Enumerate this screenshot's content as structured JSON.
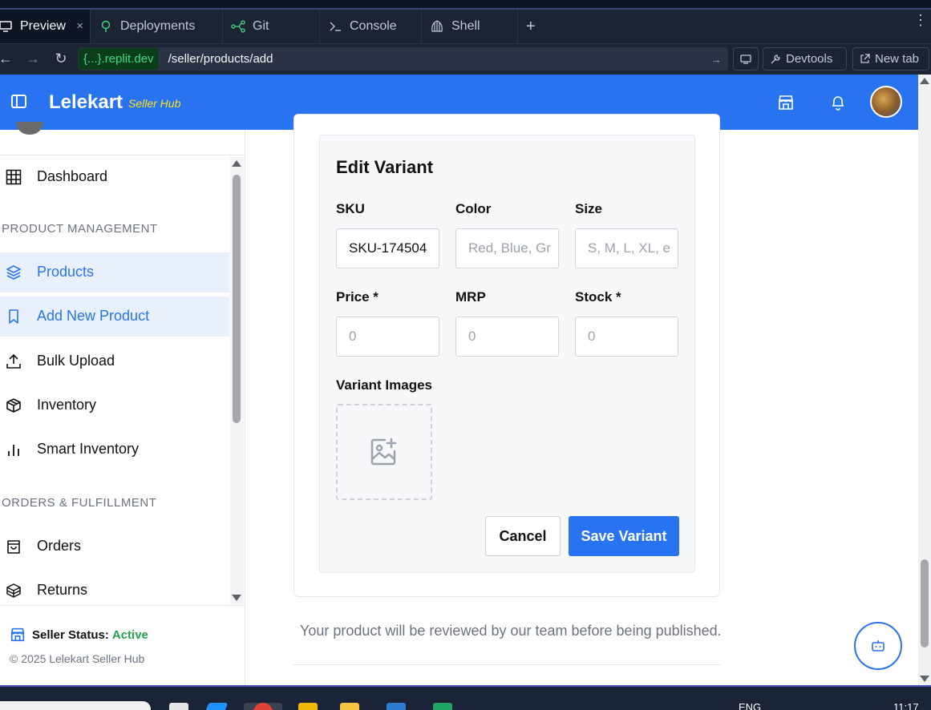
{
  "browser": {
    "tabs": [
      {
        "label": "Preview",
        "active": true,
        "icon": "monitor-icon"
      },
      {
        "label": "Deployments",
        "icon": "deploy-icon"
      },
      {
        "label": "Git",
        "icon": "git-branch-icon"
      },
      {
        "label": "Console",
        "icon": "terminal-icon"
      },
      {
        "label": "Shell",
        "icon": "shell-icon"
      }
    ],
    "close_glyph": "×",
    "new_tab_glyph": "+",
    "url_domain": "{...}.replit.dev",
    "url_path": "/seller/products/add",
    "devtools_label": "Devtools",
    "newtab_label": "New tab"
  },
  "header": {
    "brand": "Lelekart",
    "brand_sub": "Seller Hub"
  },
  "sidebar": {
    "items": [
      {
        "label": "Dashboard",
        "icon": "grid-icon",
        "active": false
      },
      {
        "label": "Products",
        "icon": "layers-icon",
        "active": true
      },
      {
        "label": "Add New Product",
        "icon": "bookmark-icon",
        "active": true
      },
      {
        "label": "Bulk Upload",
        "icon": "upload-icon",
        "active": false
      },
      {
        "label": "Inventory",
        "icon": "box-icon",
        "active": false
      },
      {
        "label": "Smart Inventory",
        "icon": "bar-chart-icon",
        "active": false
      },
      {
        "label": "Orders",
        "icon": "shopping-bag-icon",
        "active": false
      },
      {
        "label": "Returns",
        "icon": "package-icon",
        "active": false
      }
    ],
    "sections": {
      "product_management": "PRODUCT MANAGEMENT",
      "orders_fulfillment": "ORDERS & FULFILLMENT"
    },
    "status_label": "Seller Status:",
    "status_value": "Active",
    "copyright": "© 2025 Lelekart Seller Hub"
  },
  "variant_form": {
    "title": "Edit Variant",
    "sku_label": "SKU",
    "sku_value": "SKU-174504",
    "color_label": "Color",
    "color_placeholder": "Red, Blue, Gr",
    "size_label": "Size",
    "size_placeholder": "S, M, L, XL, e",
    "price_label": "Price *",
    "price_placeholder": "0",
    "mrp_label": "MRP",
    "mrp_placeholder": "0",
    "stock_label": "Stock *",
    "stock_placeholder": "0",
    "images_label": "Variant Images",
    "cancel_label": "Cancel",
    "save_label": "Save Variant"
  },
  "review_note": "Your product will be reviewed by our team before being published.",
  "taskbar": {
    "lang": "ENG",
    "time": "11:17"
  },
  "colors": {
    "brand_blue": "#2874f0",
    "brand_yellow": "#ffe11b",
    "active_green": "#22a04b"
  }
}
